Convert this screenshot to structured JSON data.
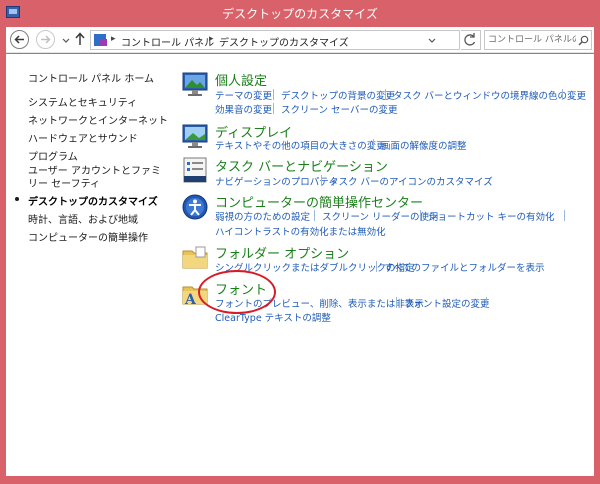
{
  "window": {
    "title": "デスクトップのカスタマイズ"
  },
  "toolbar": {
    "breadcrumb": [
      "コントロール パネル",
      "デスクトップのカスタマイズ"
    ],
    "search_placeholder": "コントロール パネルの検索"
  },
  "left_nav": {
    "home": "コントロール パネル ホーム",
    "items": [
      "システムとセキュリティ",
      "ネットワークとインターネット",
      "ハードウェアとサウンド",
      "プログラム",
      "ユーザー アカウントとファミリー セーフティ",
      "デスクトップのカスタマイズ",
      "時計、言語、および地域",
      "コンピューターの簡単操作"
    ],
    "current_index": 5
  },
  "categories": [
    {
      "title": "個人設定",
      "icon": "personalization-icon",
      "links": [
        [
          "テーマの変更",
          "デスクトップの背景の変更",
          "タスク バーとウィンドウの境界線の色の変更"
        ],
        [
          "効果音の変更",
          "スクリーン セーバーの変更"
        ]
      ]
    },
    {
      "title": "ディスプレイ",
      "icon": "display-icon",
      "links": [
        [
          "テキストやその他の項目の大きさの変更",
          "画面の解像度の調整"
        ]
      ]
    },
    {
      "title": "タスク バーとナビゲーション",
      "icon": "taskbar-icon",
      "links": [
        [
          "ナビゲーションのプロパティ",
          "タスク バーのアイコンのカスタマイズ"
        ]
      ]
    },
    {
      "title": "コンピューターの簡単操作センター",
      "icon": "ease-of-access-icon",
      "links": [
        [
          "弱視の方のための設定",
          "スクリーン リーダーの使用",
          "ショートカット キーの有効化"
        ],
        [
          "ハイコントラストの有効化または無効化"
        ]
      ]
    },
    {
      "title": "フォルダー オプション",
      "icon": "folder-options-icon",
      "links": [
        [
          "シングルクリックまたはダブルクリックの指定",
          "すべてのファイルとフォルダーを表示"
        ]
      ]
    },
    {
      "title": "フォント",
      "icon": "fonts-icon",
      "links": [
        [
          "フォントのプレビュー、削除、表示または非表示",
          "フォント設定の変更"
        ],
        [
          "ClearType テキストの調整"
        ]
      ]
    }
  ],
  "colors": {
    "titlebar": "#d9626a",
    "category_title": "#1a7f1a",
    "link": "#1e5bb8",
    "highlight_circle": "#d81b24"
  }
}
